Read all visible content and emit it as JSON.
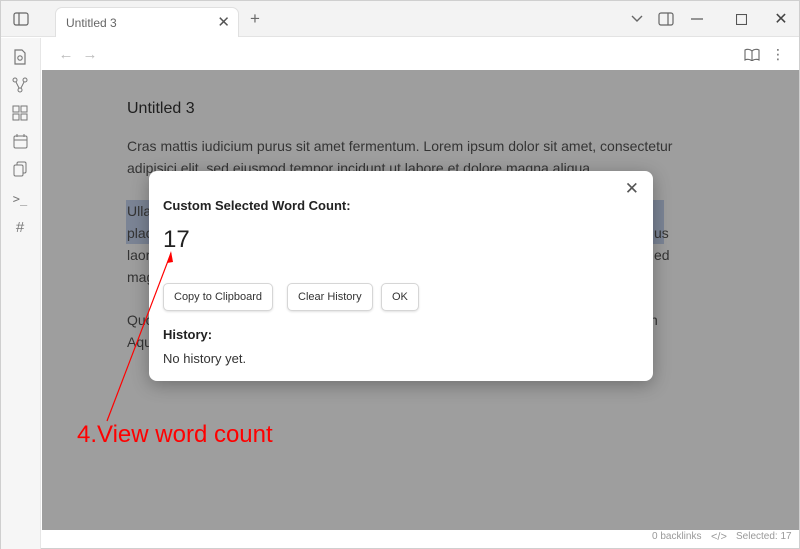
{
  "tab": {
    "title": "Untitled 3"
  },
  "note": {
    "title": "Untitled 3",
    "para1_line1": "Cras mattis iudicium purus sit amet fermentum. Lorem ipsum dolor sit amet, consectetur",
    "para1_line2": "adipisici elit, sed eiusmod tempor incidunt ut labore et dolore magna aliqua.",
    "para2_line1": "Ulla",
    "para2_line2": "plac",
    "para2_line3": "laor",
    "para2_line4": "mag",
    "para2_line2_end": "us",
    "para2_line3_end": "ed",
    "para3_line1": "Quo",
    "para3_line2": "Aqu",
    "para3_line1_end": "n"
  },
  "modal": {
    "heading": "Custom Selected Word Count:",
    "count": "17",
    "buttons": {
      "copy": "Copy to Clipboard",
      "clear": "Clear History",
      "ok": "OK"
    },
    "history_heading": "History:",
    "history_empty": "No history yet."
  },
  "status": {
    "backlinks": "0 backlinks",
    "selected": "Selected: 17"
  },
  "annotation": {
    "text": "4.View word count",
    "color": "#ff0000"
  }
}
